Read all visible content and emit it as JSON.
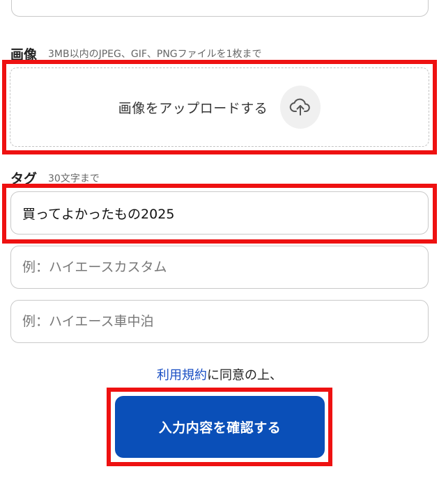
{
  "image_section": {
    "title": "画像",
    "note": "3MB以内のJPEG、GIF、PNGファイルを1枚まで",
    "upload_label": "画像をアップロードする",
    "upload_icon": "upload-cloud-arrow-icon"
  },
  "tag_section": {
    "title": "タグ",
    "note": "30文字まで",
    "inputs": [
      {
        "value": "買ってよかったもの2025",
        "placeholder": ""
      },
      {
        "value": "",
        "placeholder": "例：ハイエースカスタム"
      },
      {
        "value": "",
        "placeholder": "例：ハイエース車中泊"
      }
    ]
  },
  "agreement": {
    "terms_link": "利用規約",
    "suffix": "に同意の上、"
  },
  "submit": {
    "label": "入力内容を確認する"
  },
  "colors": {
    "highlight": "#ee1111",
    "primary": "#0a4fb8",
    "link": "#1a4fc4"
  }
}
